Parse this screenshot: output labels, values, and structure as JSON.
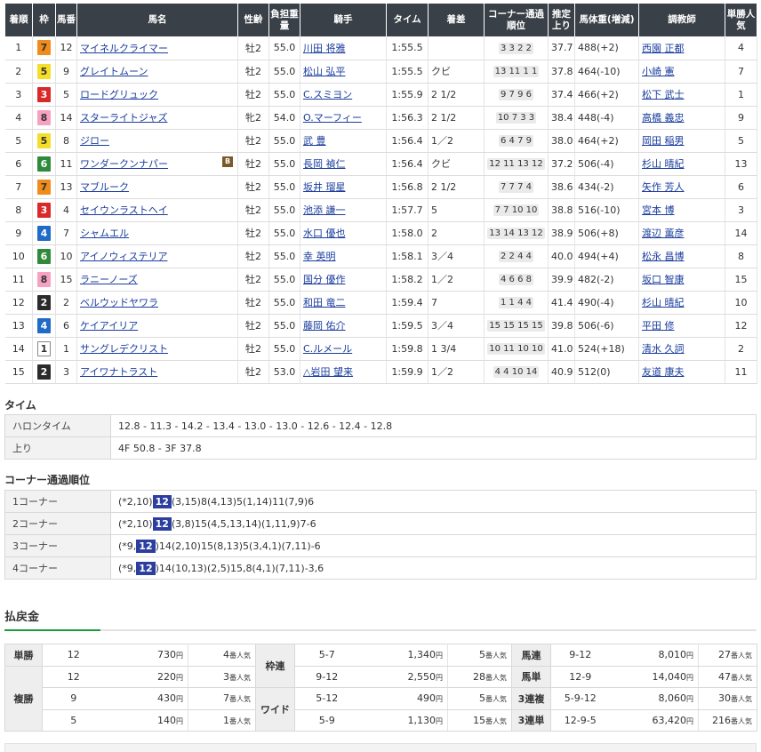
{
  "headers": {
    "rank": "着順",
    "waku": "枠",
    "num": "馬番",
    "name": "馬名",
    "sex_age": "性齢",
    "weight": "負担重量",
    "jockey": "騎手",
    "time": "タイム",
    "margin": "着差",
    "passing": "コーナー通過順位",
    "last3f": "推定上り",
    "horse_weight": "馬体重(増減)",
    "trainer": "調教師",
    "popularity": "単勝人気"
  },
  "rows": [
    {
      "rank": "1",
      "waku": "7",
      "num": "12",
      "name": "マイネルクライマー",
      "blinker": "",
      "sex_age": "牡2",
      "weight": "55.0",
      "jockey": "川田 将雅",
      "time": "1:55.5",
      "margin": "",
      "passing": "3 3 2 2",
      "last3f": "37.7",
      "horse_weight": "488(+2)",
      "trainer": "西園 正都",
      "popularity": "4"
    },
    {
      "rank": "2",
      "waku": "5",
      "num": "9",
      "name": "グレイトムーン",
      "blinker": "",
      "sex_age": "牡2",
      "weight": "55.0",
      "jockey": "松山 弘平",
      "time": "1:55.5",
      "margin": "クビ",
      "passing": "13 11 1 1",
      "last3f": "37.8",
      "horse_weight": "464(-10)",
      "trainer": "小崎 憲",
      "popularity": "7"
    },
    {
      "rank": "3",
      "waku": "3",
      "num": "5",
      "name": "ロードグリュック",
      "blinker": "",
      "sex_age": "牡2",
      "weight": "55.0",
      "jockey": "C.スミヨン",
      "time": "1:55.9",
      "margin": "2 1/2",
      "passing": "9 7 9 6",
      "last3f": "37.4",
      "horse_weight": "466(+2)",
      "trainer": "松下 武士",
      "popularity": "1"
    },
    {
      "rank": "4",
      "waku": "8",
      "num": "14",
      "name": "スターライトジャズ",
      "blinker": "",
      "sex_age": "牝2",
      "weight": "54.0",
      "jockey": "O.マーフィー",
      "time": "1:56.3",
      "margin": "2 1/2",
      "passing": "10 7 3 3",
      "last3f": "38.4",
      "horse_weight": "448(-4)",
      "trainer": "高橋 義忠",
      "popularity": "9"
    },
    {
      "rank": "5",
      "waku": "5",
      "num": "8",
      "name": "ジロー",
      "blinker": "",
      "sex_age": "牡2",
      "weight": "55.0",
      "jockey": "武 豊",
      "time": "1:56.4",
      "margin": "1／2",
      "passing": "6 4 7 9",
      "last3f": "38.0",
      "horse_weight": "464(+2)",
      "trainer": "岡田 稲男",
      "popularity": "5"
    },
    {
      "rank": "6",
      "waku": "6",
      "num": "11",
      "name": "ワンダークンナパー",
      "blinker": "B",
      "sex_age": "牡2",
      "weight": "55.0",
      "jockey": "長岡 禎仁",
      "time": "1:56.4",
      "margin": "クビ",
      "passing": "12 11 13 12",
      "last3f": "37.2",
      "horse_weight": "506(-4)",
      "trainer": "杉山 晴紀",
      "popularity": "13"
    },
    {
      "rank": "7",
      "waku": "7",
      "num": "13",
      "name": "マブルーク",
      "blinker": "",
      "sex_age": "牡2",
      "weight": "55.0",
      "jockey": "坂井 瑠星",
      "time": "1:56.8",
      "margin": "2 1/2",
      "passing": "7 7 7 4",
      "last3f": "38.6",
      "horse_weight": "434(-2)",
      "trainer": "矢作 芳人",
      "popularity": "6"
    },
    {
      "rank": "8",
      "waku": "3",
      "num": "4",
      "name": "セイウンラストヘイ",
      "blinker": "",
      "sex_age": "牡2",
      "weight": "55.0",
      "jockey": "池添 謙一",
      "time": "1:57.7",
      "margin": "5",
      "passing": "7 7 10 10",
      "last3f": "38.8",
      "horse_weight": "516(-10)",
      "trainer": "宮本 博",
      "popularity": "3"
    },
    {
      "rank": "9",
      "waku": "4",
      "num": "7",
      "name": "シャムエル",
      "blinker": "",
      "sex_age": "牡2",
      "weight": "55.0",
      "jockey": "水口 優也",
      "time": "1:58.0",
      "margin": "2",
      "passing": "13 14 13 12",
      "last3f": "38.9",
      "horse_weight": "506(+8)",
      "trainer": "渡辺 薫彦",
      "popularity": "14"
    },
    {
      "rank": "10",
      "waku": "6",
      "num": "10",
      "name": "アイノウィステリア",
      "blinker": "",
      "sex_age": "牡2",
      "weight": "55.0",
      "jockey": "幸 英明",
      "time": "1:58.1",
      "margin": "3／4",
      "passing": "2 2 4 4",
      "last3f": "40.0",
      "horse_weight": "494(+4)",
      "trainer": "松永 昌博",
      "popularity": "8"
    },
    {
      "rank": "11",
      "waku": "8",
      "num": "15",
      "name": "ラニーノーズ",
      "blinker": "",
      "sex_age": "牡2",
      "weight": "55.0",
      "jockey": "国分 優作",
      "time": "1:58.2",
      "margin": "1／2",
      "passing": "4 6 6 8",
      "last3f": "39.9",
      "horse_weight": "482(-2)",
      "trainer": "坂口 智康",
      "popularity": "15"
    },
    {
      "rank": "12",
      "waku": "2",
      "num": "2",
      "name": "ベルウッドヤワラ",
      "blinker": "",
      "sex_age": "牡2",
      "weight": "55.0",
      "jockey": "和田 竜二",
      "time": "1:59.4",
      "margin": "7",
      "passing": "1 1 4 4",
      "last3f": "41.4",
      "horse_weight": "490(-4)",
      "trainer": "杉山 晴紀",
      "popularity": "10"
    },
    {
      "rank": "13",
      "waku": "4",
      "num": "6",
      "name": "ケイアイリア",
      "blinker": "",
      "sex_age": "牡2",
      "weight": "55.0",
      "jockey": "藤岡 佑介",
      "time": "1:59.5",
      "margin": "3／4",
      "passing": "15 15 15 15",
      "last3f": "39.8",
      "horse_weight": "506(-6)",
      "trainer": "平田 修",
      "popularity": "12"
    },
    {
      "rank": "14",
      "waku": "1",
      "num": "1",
      "name": "サングレデクリスト",
      "blinker": "",
      "sex_age": "牡2",
      "weight": "55.0",
      "jockey": "C.ルメール",
      "time": "1:59.8",
      "margin": "1 3/4",
      "passing": "10 11 10 10",
      "last3f": "41.0",
      "horse_weight": "524(+18)",
      "trainer": "清水 久詞",
      "popularity": "2"
    },
    {
      "rank": "15",
      "waku": "2",
      "num": "3",
      "name": "アイワナトラスト",
      "blinker": "",
      "sex_age": "牡2",
      "weight": "53.0",
      "jockey": "△岩田 望来",
      "time": "1:59.9",
      "margin": "1／2",
      "passing": "4 4 10 14",
      "last3f": "40.9",
      "horse_weight": "512(0)",
      "trainer": "友道 康夫",
      "popularity": "11"
    }
  ],
  "time_section": {
    "title": "タイム",
    "furlong_label": "ハロンタイム",
    "furlong_value": "12.8 - 11.3 - 14.2 - 13.4 - 13.0 - 13.0 - 12.6 - 12.4 - 12.8",
    "agari_label": "上り",
    "agari_value": "4F 50.8 - 3F 37.8"
  },
  "corner_section": {
    "title": "コーナー通過順位",
    "corners": [
      {
        "label": "1コーナー",
        "pre": "(*2,10)",
        "hl": "12",
        "post": "(3,15)8(4,13)5(1,14)11(7,9)6"
      },
      {
        "label": "2コーナー",
        "pre": "(*2,10)",
        "hl": "12",
        "post": "(3,8)15(4,5,13,14)(1,11,9)7-6"
      },
      {
        "label": "3コーナー",
        "pre": "(*9,",
        "hl": "12",
        "post": ")14(2,10)15(8,13)5(3,4,1)(7,11)-6"
      },
      {
        "label": "4コーナー",
        "pre": "(*9,",
        "hl": "12",
        "post": ")14(10,13)(2,5)15,8(4,1)(7,11)-3,6"
      }
    ]
  },
  "payout": {
    "title": "払戻金",
    "yen_unit": "円",
    "pop_unit": "番人気",
    "col1": [
      {
        "type": "単勝",
        "num": "12",
        "yen": "730",
        "pop": "4"
      },
      {
        "type": "",
        "num": "12",
        "yen": "220",
        "pop": "3"
      },
      {
        "type": "複勝",
        "num": "9",
        "yen": "430",
        "pop": "7"
      },
      {
        "type": "",
        "num": "5",
        "yen": "140",
        "pop": "1"
      }
    ],
    "col2": [
      {
        "type": "枠連",
        "num": "5-7",
        "yen": "1,340",
        "pop": "5"
      },
      {
        "type": "",
        "num": "9-12",
        "yen": "2,550",
        "pop": "28"
      },
      {
        "type": "ワイド",
        "num": "5-12",
        "yen": "490",
        "pop": "5"
      },
      {
        "type": "",
        "num": "5-9",
        "yen": "1,130",
        "pop": "15"
      }
    ],
    "col3": [
      {
        "type": "馬連",
        "num": "9-12",
        "yen": "8,010",
        "pop": "27"
      },
      {
        "type": "馬単",
        "num": "12-9",
        "yen": "14,040",
        "pop": "47"
      },
      {
        "type": "3連複",
        "num": "5-9-12",
        "yen": "8,060",
        "pop": "30"
      },
      {
        "type": "3連単",
        "num": "12-9-5",
        "yen": "63,420",
        "pop": "216"
      }
    ]
  },
  "colors": {
    "header_bg": "#3a4047",
    "link": "#1a3d9e",
    "highlight": "#2c3fa0",
    "accent_line": "#1f9a3a"
  }
}
